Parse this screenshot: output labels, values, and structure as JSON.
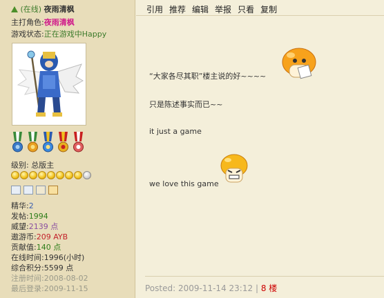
{
  "profile": {
    "online_status": "(在线)",
    "username": "夜雨清枫",
    "role_label": "主打角色:",
    "role_value": "夜雨清枫",
    "game_status_label": "游戏状态:",
    "game_status_value": "正在游戏中Happy",
    "level_label": "级别:",
    "level_value": "总版主",
    "stars_gold": 8,
    "stars_silver": 1,
    "stats": [
      {
        "label": "精华:",
        "value": "2",
        "color": "blue"
      },
      {
        "label": "发帖:",
        "value": "1994",
        "color": "green"
      },
      {
        "label": "威望:",
        "value": "2139 点",
        "color": "purple"
      },
      {
        "label": "遨游币:",
        "value": "209 AYB",
        "color": "red"
      },
      {
        "label": "贡献值:",
        "value": "140 点",
        "color": "darkgreen"
      },
      {
        "label": "在线时间:",
        "value": "1996(小时)",
        "color": "plain"
      },
      {
        "label": "综合积分:",
        "value": "5599 点",
        "color": "plain"
      },
      {
        "label": "注册时间:",
        "value": "2008-08-02",
        "color": "grey"
      },
      {
        "label": "最后登录:",
        "value": "2009-11-15",
        "color": "grey"
      }
    ]
  },
  "toolbar": {
    "quote": "引用",
    "recommend": "推荐",
    "edit": "编辑",
    "report": "举报",
    "only_view": "只看",
    "copy": "复制"
  },
  "post": {
    "line1": "“大家各尽其职”楼主说的好~~~~",
    "line2": "只是陈述事实而已~~",
    "line3": "it just a game",
    "line4": "we love this game"
  },
  "footer": {
    "posted": "Posted: 2009-11-14 23:12",
    "separator": "|",
    "floor": "8 楼"
  },
  "colors": {
    "left_bg": "#e8ddba",
    "right_bg": "#f4efda",
    "role": "#d01c8b",
    "floor": "#cc0000"
  }
}
